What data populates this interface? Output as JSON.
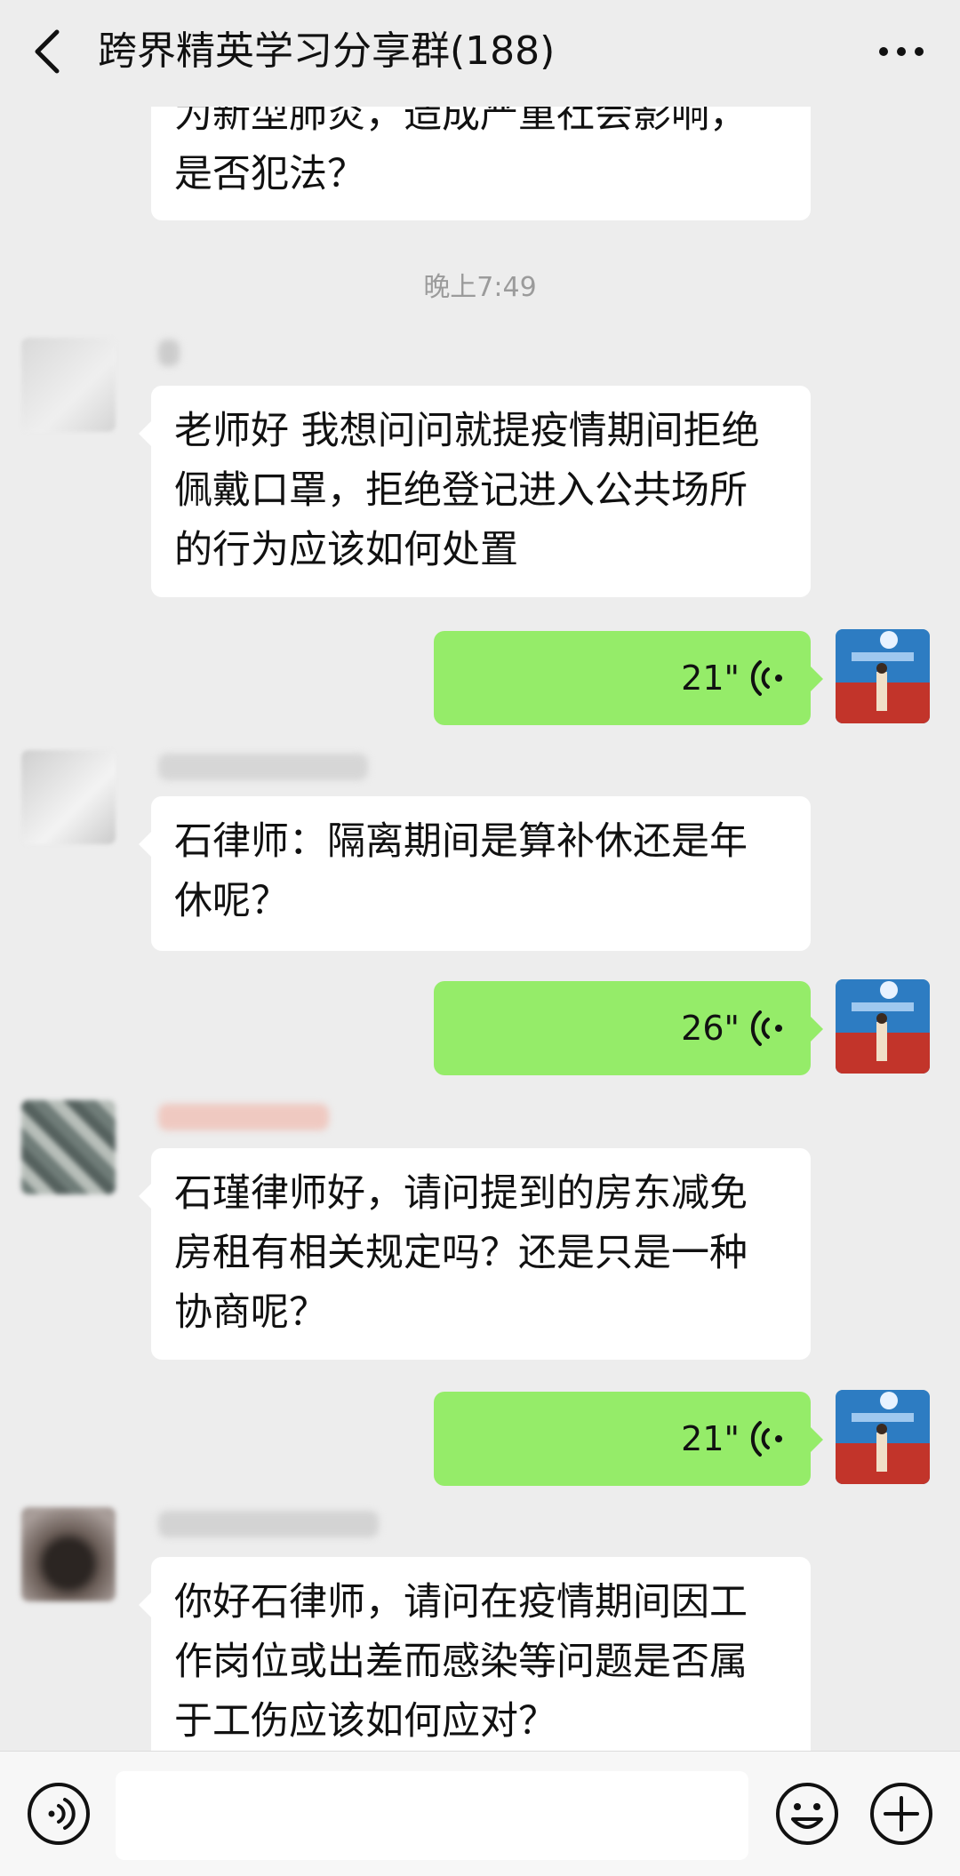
{
  "header": {
    "title": "跨界精英学习分享群(188)",
    "back_icon": "chevron-left-icon",
    "more_icon": "more-dots-icon"
  },
  "messages": {
    "top_partial": {
      "lines": [
        "为新型肺炎，造成严重社会影响，",
        "是否犯法？"
      ]
    },
    "timestamp": "晚上7:49",
    "m1": {
      "lines": [
        "老师好 我想问问就提疫情期间拒绝",
        "佩戴口罩，拒绝登记进入公共场所",
        "的行为应该如何处置"
      ]
    },
    "v1": {
      "duration": "21\""
    },
    "m2": {
      "lines": [
        "石律师：隔离期间是算补休还是年",
        "休呢？"
      ]
    },
    "v2": {
      "duration": "26\""
    },
    "m3": {
      "lines": [
        "石瑾律师好，请问提到的房东减免",
        "房租有相关规定吗？还是只是一种",
        "协商呢？"
      ]
    },
    "v3": {
      "duration": "21\""
    },
    "m4": {
      "lines": [
        "你好石律师，请问在疫情期间因工",
        "作岗位或出差而感染等问题是否属",
        "于工伤应该如何应对？"
      ]
    }
  },
  "bottom_bar": {
    "voice_icon": "voice-input-icon",
    "emoji_icon": "emoji-icon",
    "plus_icon": "plus-icon"
  },
  "colors": {
    "background": "#ededed",
    "bubble_received": "#ffffff",
    "bubble_sent": "#95ec69",
    "timestamp": "#9b9b9b"
  }
}
